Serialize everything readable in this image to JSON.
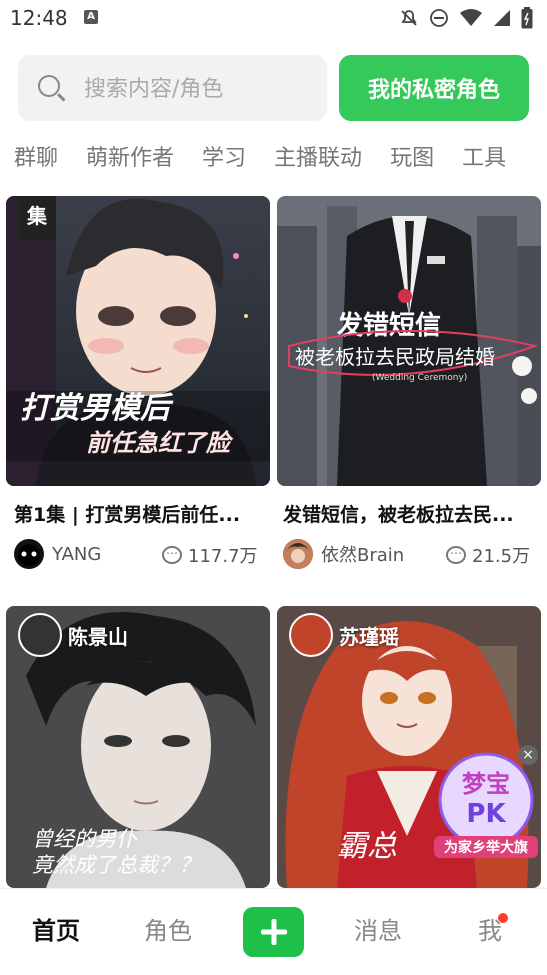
{
  "status_bar": {
    "time": "12:48",
    "app_badge": "A"
  },
  "search": {
    "placeholder": "搜索内容/角色",
    "value": ""
  },
  "primary_button": {
    "label": "我的私密角色"
  },
  "categories": [
    "群聊",
    "萌新作者",
    "学习",
    "主播联动",
    "玩图",
    "工具"
  ],
  "feed": [
    {
      "title": "第1集 | 打赏男模后前任...",
      "corner_tag": "集",
      "overlay_text_1": "打赏男模后",
      "overlay_text_2": "前任急红了脸",
      "author": "YANG",
      "count": "117.7万"
    },
    {
      "title": "发错短信，被老板拉去民...",
      "overlay_text_1": "发错短信",
      "overlay_text_2": "被老板拉去民政局结婚",
      "overlay_text_3": "(Wedding Ceremony)",
      "author": "依然Brain",
      "count": "21.5万"
    },
    {
      "name": "陈景山",
      "overlay_text_1": "曾经的男仆",
      "overlay_text_2": "竟然成了总裁？？"
    },
    {
      "name": "苏瑾瑶",
      "overlay_text_1": "霸总"
    }
  ],
  "pk_badge": {
    "line1": "梦宝",
    "line2": "PK",
    "banner": "为家乡举大旗"
  },
  "nav": {
    "home": "首页",
    "roles": "角色",
    "messages": "消息",
    "me": "我"
  },
  "colors": {
    "accent": "#35c85a",
    "nav_plus": "#1fc04a",
    "notify_dot": "#ff3b30"
  }
}
